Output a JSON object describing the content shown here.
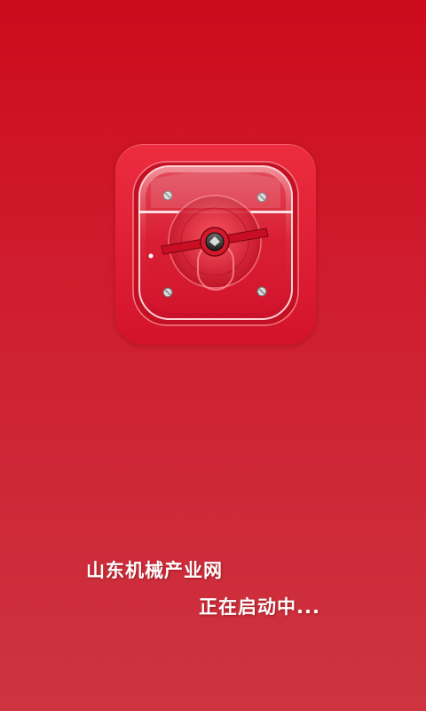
{
  "splash": {
    "app_name": "山东机械产业网",
    "status": "正在启动中...",
    "logo_icon": "machine-dial-icon"
  },
  "colors": {
    "background_top": "#cc0b1c",
    "background_bottom": "#cd3440",
    "icon_red": "#e52034",
    "text": "#ffffff"
  }
}
